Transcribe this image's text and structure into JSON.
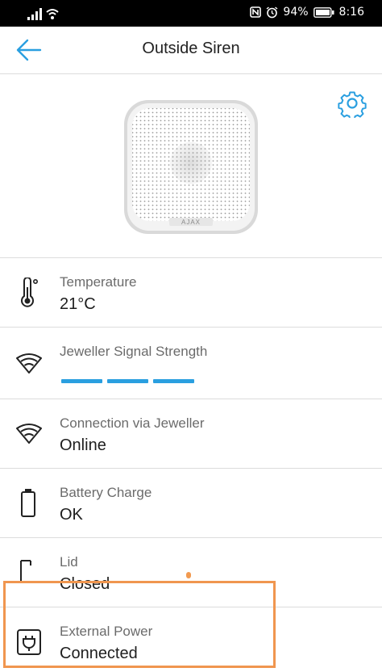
{
  "status_bar": {
    "battery_text": "94%",
    "time": "8:16",
    "icons": [
      "signal-icon",
      "wifi-icon",
      "nfc-icon",
      "alarm-icon",
      "battery-icon"
    ]
  },
  "app_bar": {
    "title": "Outside Siren",
    "back_icon": "back-arrow-icon",
    "accent_color": "#2a9fe0"
  },
  "device": {
    "image": "siren-device-image",
    "brand_mark": "AJAX",
    "settings_icon": "gear-icon"
  },
  "rows": [
    {
      "icon": "thermometer-icon",
      "label": "Temperature",
      "value": "21°C"
    },
    {
      "icon": "jeweller-signal-icon",
      "label": "Jeweller Signal Strength",
      "value": "",
      "signal_bars_filled": 3,
      "signal_bars_total": 3
    },
    {
      "icon": "jeweller-signal-icon",
      "label": "Connection via Jeweller",
      "value": "Online"
    },
    {
      "icon": "battery-icon",
      "label": "Battery Charge",
      "value": "OK"
    },
    {
      "icon": "lid-icon",
      "label": "Lid",
      "value": "Closed"
    },
    {
      "icon": "power-plug-icon",
      "label": "External Power",
      "value": "Connected"
    }
  ],
  "highlight_color": "#f0964f"
}
